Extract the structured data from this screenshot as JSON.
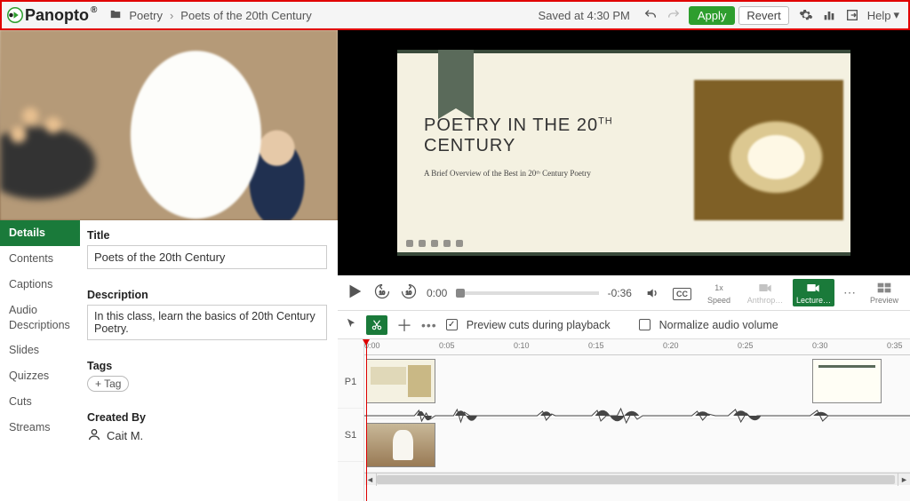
{
  "brand": "Panopto",
  "breadcrumb": {
    "folder": "Poetry",
    "title": "Poets of the 20th Century"
  },
  "status": {
    "saved": "Saved at 4:30 PM"
  },
  "buttons": {
    "apply": "Apply",
    "revert": "Revert",
    "help": "Help"
  },
  "sidebar": {
    "items": [
      "Details",
      "Contents",
      "Captions",
      "Audio Descriptions",
      "Slides",
      "Quizzes",
      "Cuts",
      "Streams"
    ],
    "active": 0
  },
  "details": {
    "title_label": "Title",
    "title_value": "Poets of the 20th Century",
    "description_label": "Description",
    "description_value": "In this class, learn the basics of 20th Century Poetry.",
    "tags_label": "Tags",
    "add_tag": "+ Tag",
    "created_by_label": "Created By",
    "creator_name": "Cait M."
  },
  "slide": {
    "title_a": "POETRY IN THE 20",
    "title_sup": "TH",
    "title_b": "CENTURY",
    "subtitle": "A Brief Overview of the Best in 20ᵗʰ Century Poetry"
  },
  "player": {
    "current": "0:00",
    "remaining": "-0:36",
    "speed_value": "1x",
    "speed_label": "Speed",
    "source_a": "Anthrop…",
    "source_b": "Lecture…",
    "preview": "Preview"
  },
  "editbar": {
    "preview_cuts": "Preview cuts during playback",
    "normalize": "Normalize audio volume"
  },
  "timeline": {
    "ticks": [
      "0:00",
      "0:05",
      "0:10",
      "0:15",
      "0:20",
      "0:25",
      "0:30",
      "0:35"
    ],
    "tracks": [
      "P1",
      "S1"
    ]
  }
}
